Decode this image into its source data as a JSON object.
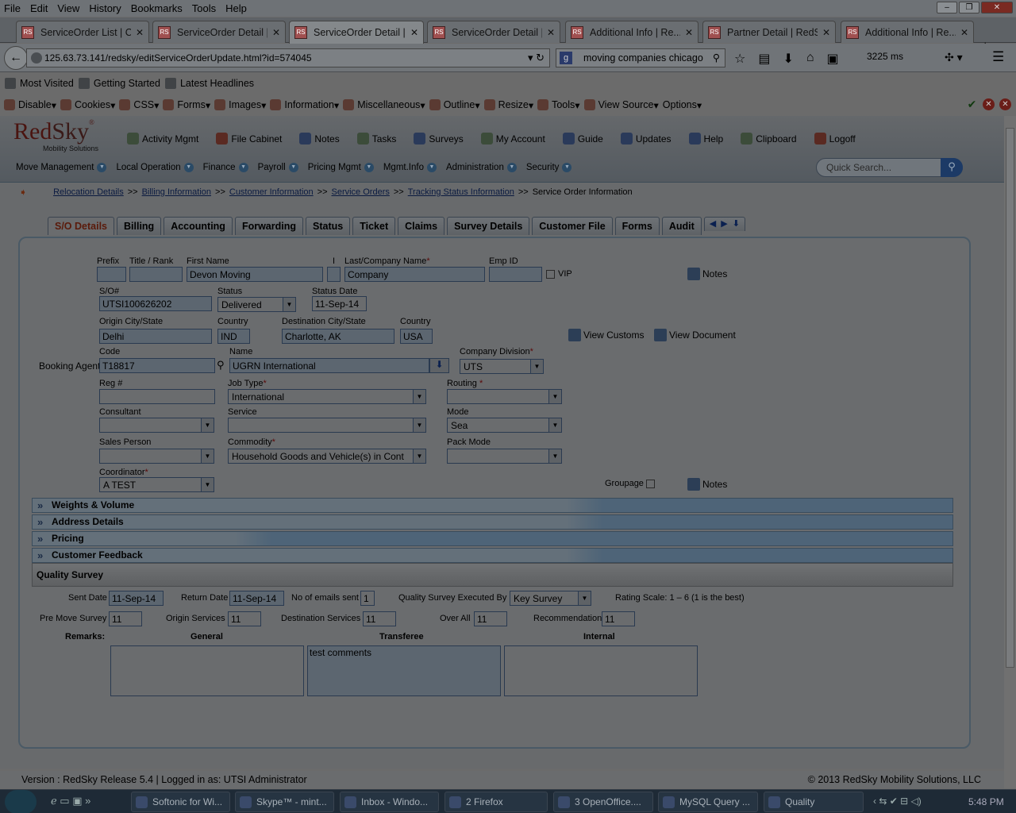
{
  "menubar": {
    "items": [
      "File",
      "Edit",
      "View",
      "History",
      "Bookmarks",
      "Tools",
      "Help"
    ]
  },
  "tabs": [
    {
      "label": "ServiceOrder List | C..."
    },
    {
      "label": "ServiceOrder Detail |..."
    },
    {
      "label": "ServiceOrder Detail |..."
    },
    {
      "label": "ServiceOrder Detail |..."
    },
    {
      "label": "Additional Info | Re..."
    },
    {
      "label": "Partner Detail | RedS..."
    },
    {
      "label": "Additional Info | Re..."
    }
  ],
  "nav": {
    "url": "125.63.73.141/redsky/editServiceOrderUpdate.html?id=574045",
    "search": "moving companies chicago",
    "time": "3225 ms"
  },
  "bookmarks": [
    "Most Visited",
    "Getting Started",
    "Latest Headlines"
  ],
  "devbar": [
    "Disable",
    "Cookies",
    "CSS",
    "Forms",
    "Images",
    "Information",
    "Miscellaneous",
    "Outline",
    "Resize",
    "Tools",
    "View Source",
    "Options"
  ],
  "logo": {
    "red": "Red",
    "sky": "Sky",
    "sub": "Mobility Solutions"
  },
  "topnav": [
    "Activity Mgmt",
    "File Cabinet",
    "Notes",
    "Tasks",
    "Surveys",
    "My Account",
    "Guide",
    "Updates",
    "Help",
    "Clipboard",
    "Logoff"
  ],
  "mainmenu": [
    "Move Management",
    "Local Operation",
    "Finance",
    "Payroll",
    "Pricing Mgmt",
    "Mgmt.Info",
    "Administration",
    "Security"
  ],
  "quicksearch": {
    "placeholder": "Quick Search..."
  },
  "breadcrumbs": {
    "links": [
      "Relocation Details",
      "Billing Information",
      "Customer Information",
      "Service Orders",
      "Tracking Status Information"
    ],
    "current": "Service Order Information"
  },
  "formtabs": [
    "S/O Details",
    "Billing",
    "Accounting",
    "Forwarding",
    "Status",
    "Ticket",
    "Claims",
    "Survey Details",
    "Customer File",
    "Forms",
    "Audit"
  ],
  "form": {
    "labels": {
      "prefix": "Prefix",
      "title": "Title / Rank",
      "first": "First Name",
      "initial": "I",
      "last": "Last/Company Name",
      "empid": "Emp ID",
      "vip": "VIP",
      "notes": "Notes",
      "so": "S/O#",
      "status": "Status",
      "statusdate": "Status Date",
      "origin": "Origin City/State",
      "country": "Country",
      "dest": "Destination City/State",
      "viewcustoms": "View Customs",
      "viewdoc": "View Document",
      "code": "Code",
      "name": "Name",
      "division": "Company Division",
      "bookingagent": "Booking Agent:",
      "reg": "Reg #",
      "jobtype": "Job Type",
      "routing": "Routing",
      "consultant": "Consultant",
      "service": "Service",
      "mode": "Mode",
      "salesperson": "Sales Person",
      "commodity": "Commodity",
      "packmode": "Pack Mode",
      "coordinator": "Coordinator",
      "groupage": "Groupage"
    },
    "values": {
      "first": "Devon Moving",
      "last": "Company",
      "so": "UTSI100626202",
      "status": "Delivered",
      "statusdate": "11-Sep-14",
      "origin": "Delhi",
      "origincountry": "IND",
      "dest": "Charlotte, AK",
      "destcountry": "USA",
      "code": "T18817",
      "name": "UGRN International",
      "division": "UTS",
      "jobtype": "International",
      "mode": "Sea",
      "commodity": "Household Goods and Vehicle(s) in Cont",
      "coordinator": "A TEST"
    }
  },
  "sections": [
    "Weights & Volume",
    "Address Details",
    "Pricing",
    "Customer Feedback"
  ],
  "quality": {
    "title": "Quality Survey",
    "labels": {
      "sent": "Sent Date",
      "return": "Return Date",
      "emails": "No of emails sent",
      "executed": "Quality Survey Executed By",
      "scale": "Rating Scale:  1 – 6 (1 is the best)",
      "premove": "Pre Move Survey",
      "originsvc": "Origin Services",
      "destsvc": "Destination Services",
      "overall": "Over All",
      "recommend": "Recommendation",
      "remarks": "Remarks:",
      "general": "General",
      "transferee": "Transferee",
      "internal": "Internal"
    },
    "values": {
      "sent": "11-Sep-14",
      "return": "11-Sep-14",
      "emails": "1",
      "executed": "Key Survey",
      "premove": "11",
      "originsvc": "11",
      "destsvc": "11",
      "overall": "11",
      "recommend": "11",
      "transferee": "test comments"
    }
  },
  "footer": {
    "left": "Version : RedSky Release 5.4 | Logged in as: UTSI Administrator",
    "right": "© 2013 RedSky Mobility Solutions, LLC"
  },
  "taskbar": {
    "items": [
      "Softonic for Wi...",
      "Skype™ - mint...",
      "Inbox - Windo...",
      "2 Firefox",
      "3 OpenOffice....",
      "MySQL Query ...",
      "Quality"
    ],
    "clock": "5:48 PM"
  }
}
